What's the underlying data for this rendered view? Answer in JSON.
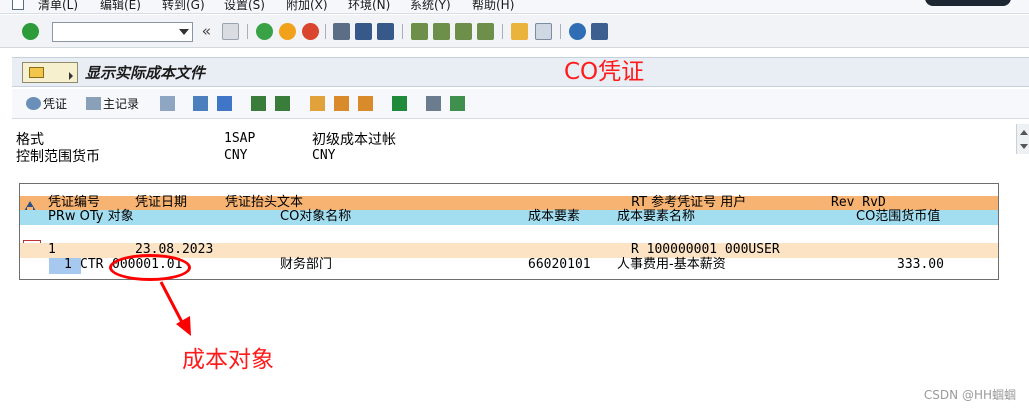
{
  "menubar": {
    "items": [
      {
        "label": "清单(L)"
      },
      {
        "label": "编辑(E)"
      },
      {
        "label": "转到(G)"
      },
      {
        "label": "设置(S)"
      },
      {
        "label": "附加(X)"
      },
      {
        "label": "环境(N)"
      },
      {
        "label": "系统(Y)"
      },
      {
        "label": "帮助(H)"
      }
    ]
  },
  "systoolbar": {
    "command_field_value": "",
    "back_chevron": "«"
  },
  "titlebar": {
    "title": "显示实际成本文件"
  },
  "apptoolbar": {
    "voucher_label": "凭证",
    "master_label": "主记录"
  },
  "header_info": {
    "rows": [
      {
        "label": "格式",
        "code": "1SAP",
        "text": "初级成本过帐"
      },
      {
        "label": "控制范围货币",
        "code": "CNY",
        "text": "CNY"
      }
    ]
  },
  "grid": {
    "header1": {
      "doc_no": "凭证编号",
      "doc_date": "凭证日期",
      "header_text": "凭证抬头文本",
      "rt_ref": "RT 参考凭证号 用户",
      "rev": "Rev RvD"
    },
    "header2": {
      "prw_oty_obj": "PRw OTy 对象",
      "co_obj_name": "CO对象名称",
      "cost_elem": "成本要素",
      "cost_elem_name": "成本要素名称",
      "co_value": "CO范围货币值"
    },
    "row1": {
      "doc_no": "1",
      "doc_date": "23.08.2023",
      "rt_ref": "R  100000001  000USER"
    },
    "row2": {
      "prw": "1",
      "oty": "CTR",
      "object": "000001.01",
      "co_obj_name": "财务部门",
      "cost_elem": "66020101",
      "cost_elem_name": "人事费用-基本薪资",
      "co_value": "333.00"
    }
  },
  "annotations": {
    "co_voucher": "CO凭证",
    "cost_object": "成本对象",
    "color": "#ff1b1b"
  },
  "watermark": "CSDN @HH蝈蝈"
}
